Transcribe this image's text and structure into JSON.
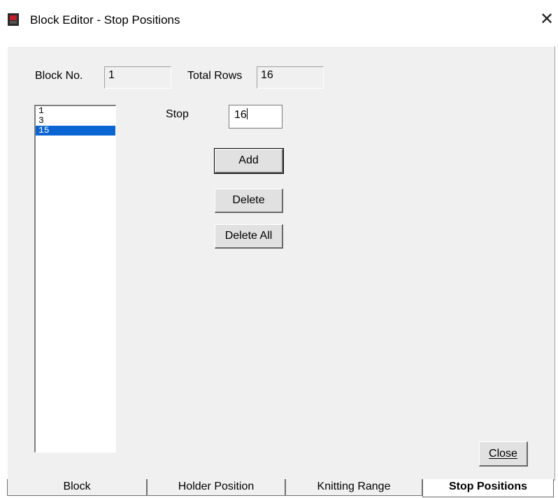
{
  "window": {
    "title": "Block Editor - Stop Positions",
    "close_glyph": "✕",
    "icon": "app-icon"
  },
  "fields": {
    "block_no_label": "Block No.",
    "block_no_value": "1",
    "total_rows_label": "Total Rows",
    "total_rows_value": "16",
    "stop_label": "Stop",
    "stop_value": "16"
  },
  "stop_list": {
    "items": [
      "1",
      "3",
      "15"
    ],
    "selected": "15"
  },
  "buttons": {
    "add": "Add",
    "delete": "Delete",
    "delete_all": "Delete All",
    "close": "Close"
  },
  "tabs": [
    {
      "label": "Block"
    },
    {
      "label": "Holder Position"
    },
    {
      "label": "Knitting Range"
    },
    {
      "label": "Stop Positions",
      "active": true
    }
  ],
  "colors": {
    "selection": "#0a64d2",
    "dialog_bg": "#f0f0f0"
  }
}
